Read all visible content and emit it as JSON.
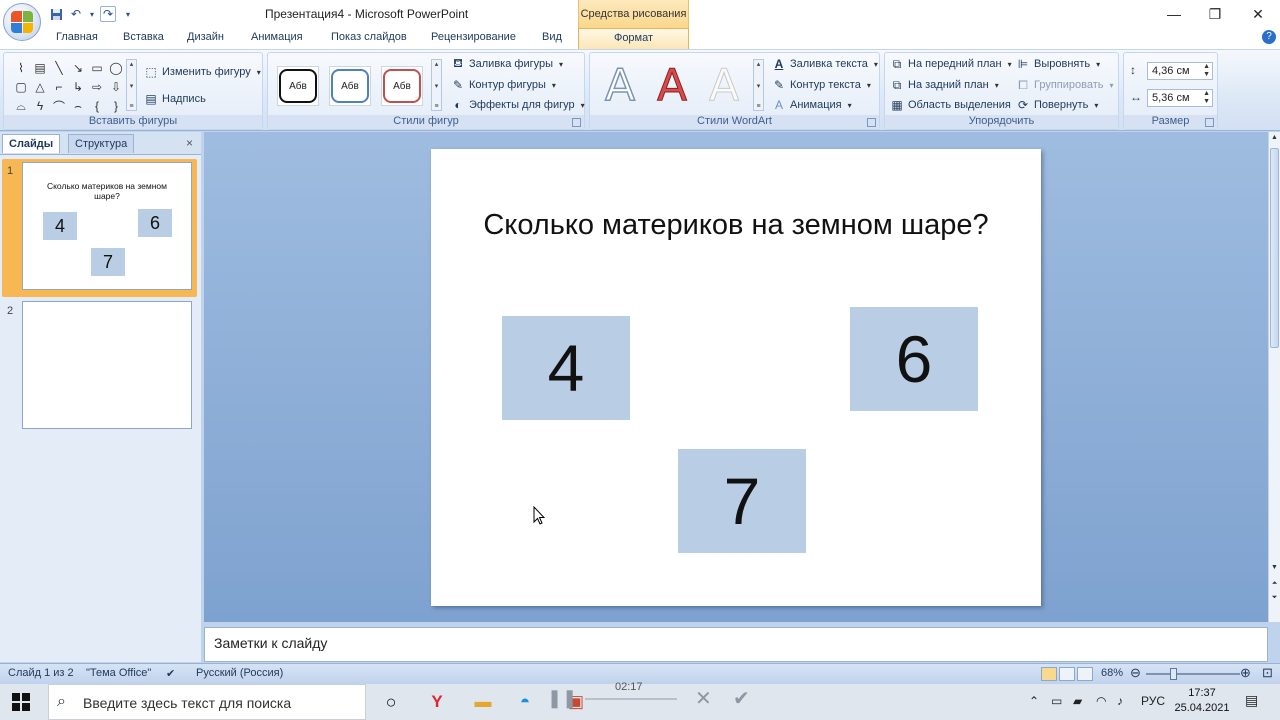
{
  "app": {
    "title": "Презентация4 - Microsoft PowerPoint",
    "context_header": "Средства рисования",
    "window_controls": [
      "—",
      "❐",
      "✕"
    ]
  },
  "tabs": [
    "Главная",
    "Вставка",
    "Дизайн",
    "Анимация",
    "Показ слайдов",
    "Рецензирование",
    "Вид"
  ],
  "active_tab": "Формат",
  "ribbon": {
    "insert_shapes": {
      "label": "Вставить фигуры",
      "edit_shape": "Изменить фигуру",
      "text_box": "Надпись"
    },
    "shape_styles": {
      "label": "Стили фигур",
      "sample": "Абв",
      "fill": "Заливка фигуры",
      "outline": "Контур фигуры",
      "effects": "Эффекты для фигур"
    },
    "wordart": {
      "label": "Стили WordArt",
      "sample": "A",
      "text_fill": "Заливка текста",
      "text_outline": "Контур текста",
      "animation": "Анимация"
    },
    "arrange": {
      "label": "Упорядочить",
      "bring_front": "На передний план",
      "send_back": "На задний план",
      "selection_pane": "Область выделения",
      "align": "Выровнять",
      "group": "Группировать",
      "rotate": "Повернуть"
    },
    "size": {
      "label": "Размер",
      "height": "4,36 см",
      "width": "5,36 см"
    }
  },
  "left_pane": {
    "tab_slides": "Слайды",
    "tab_outline": "Структура",
    "close": "×",
    "slide_numbers": [
      "1",
      "2"
    ]
  },
  "slide": {
    "title": "Сколько материков на земном шаре?",
    "boxes": [
      "4",
      "6",
      "7"
    ],
    "box_color": "#b9cde5"
  },
  "notes_placeholder": "Заметки к слайду",
  "status": {
    "slide_counter": "Слайд 1 из 2",
    "theme": "\"Тема Office\"",
    "language": "Русский (Россия)",
    "zoom": "68%"
  },
  "taskbar": {
    "search_placeholder": "Введите здесь текст для поиска",
    "recording_time": "02:17",
    "language": "РУС",
    "time": "17:37",
    "date": "25.04.2021"
  }
}
